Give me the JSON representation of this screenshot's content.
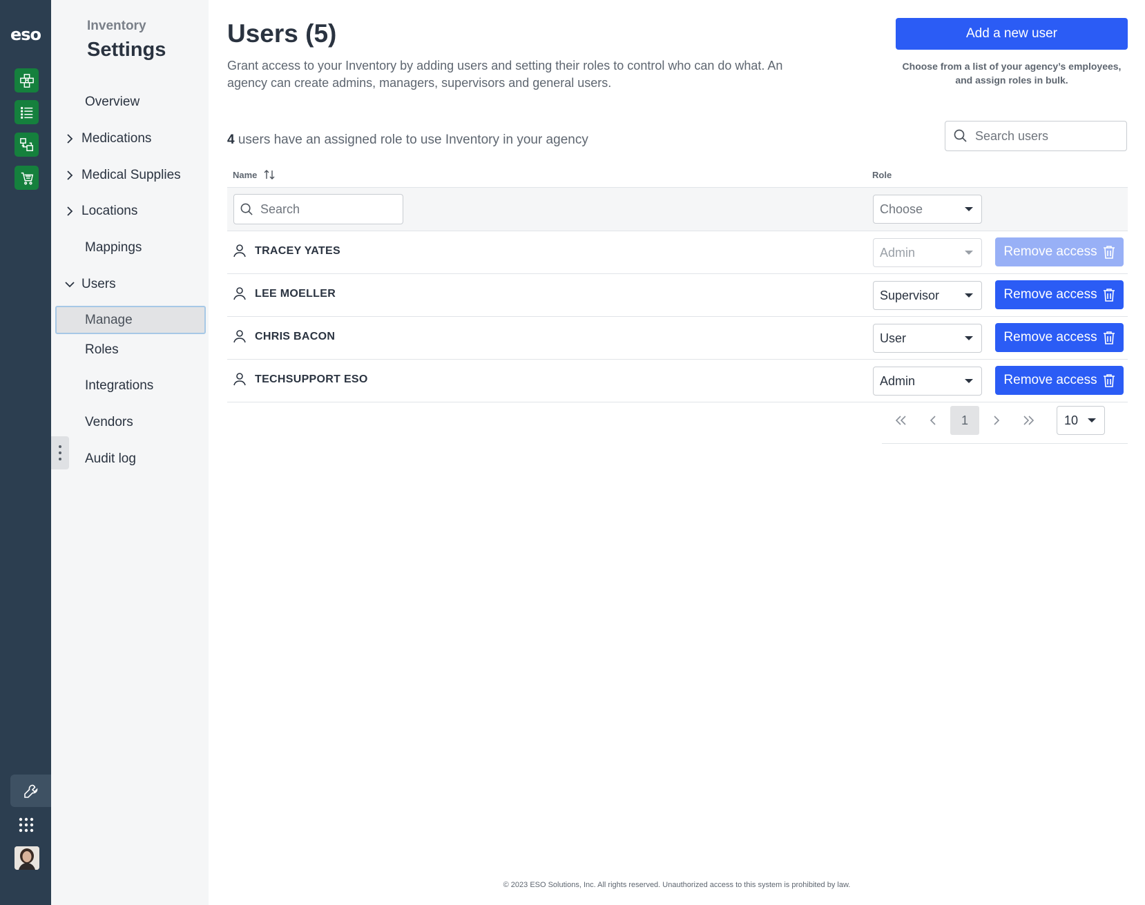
{
  "rail": {
    "logo": "eso",
    "items": [
      {
        "icon": "dashboard-grid-icon"
      },
      {
        "icon": "list-icon"
      },
      {
        "icon": "transfer-icon"
      },
      {
        "icon": "cart-icon"
      }
    ],
    "bottom": [
      {
        "icon": "wrench-icon"
      },
      {
        "icon": "apps-grid-icon"
      },
      {
        "icon": "user-avatar"
      }
    ],
    "accent": "#15803d",
    "background": "#2c3e50"
  },
  "subnav": {
    "app_name": "Inventory",
    "section_title": "Settings",
    "items": [
      {
        "label": "Overview",
        "chevron": "none"
      },
      {
        "label": "Medications",
        "chevron": "right"
      },
      {
        "label": "Medical Supplies",
        "chevron": "right"
      },
      {
        "label": "Locations",
        "chevron": "right"
      },
      {
        "label": "Mappings",
        "chevron": "none"
      },
      {
        "label": "Users",
        "chevron": "down"
      },
      {
        "label": "Manage",
        "chevron": "none",
        "active": true
      },
      {
        "label": "Roles",
        "chevron": "none"
      },
      {
        "label": "Integrations",
        "chevron": "none"
      },
      {
        "label": "Vendors",
        "chevron": "none"
      },
      {
        "label": "Audit log",
        "chevron": "none"
      }
    ]
  },
  "header": {
    "title": "Users (5)",
    "description": "Grant access to your Inventory by adding users and setting their roles to control who can do what. An agency can create admins, managers, supervisors and general users.",
    "add_button": "Add a new user",
    "add_hint": "Choose from a list of your agency’s employees, and assign roles in bulk."
  },
  "summary": {
    "count": "4",
    "text": " users have an assigned role to use Inventory in your agency"
  },
  "search": {
    "placeholder": "Search users"
  },
  "table": {
    "columns": {
      "name": "Name",
      "role": "Role"
    },
    "filters": {
      "name_placeholder": "Search",
      "role_placeholder": "Choose"
    },
    "rows": [
      {
        "name": "TRACEY YATES",
        "role": "Admin",
        "action": "Remove access",
        "disabled": true
      },
      {
        "name": "LEE MOELLER",
        "role": "Supervisor",
        "action": "Remove access",
        "disabled": false
      },
      {
        "name": "CHRIS BACON",
        "role": "User",
        "action": "Remove access",
        "disabled": false
      },
      {
        "name": "TECHSUPPORT ESO",
        "role": "Admin",
        "action": "Remove access",
        "disabled": false
      }
    ]
  },
  "pagination": {
    "first": "«",
    "prev": "‹",
    "current_page": "1",
    "next": "›",
    "last": "»",
    "per_page": "10"
  },
  "footer": "© 2023 ESO Solutions, Inc. All rights reserved. Unauthorized access to this system is prohibited by law.",
  "colors": {
    "primary": "#2b5cf5",
    "primary_disabled": "#98b0f6",
    "text": "#2a3340"
  }
}
